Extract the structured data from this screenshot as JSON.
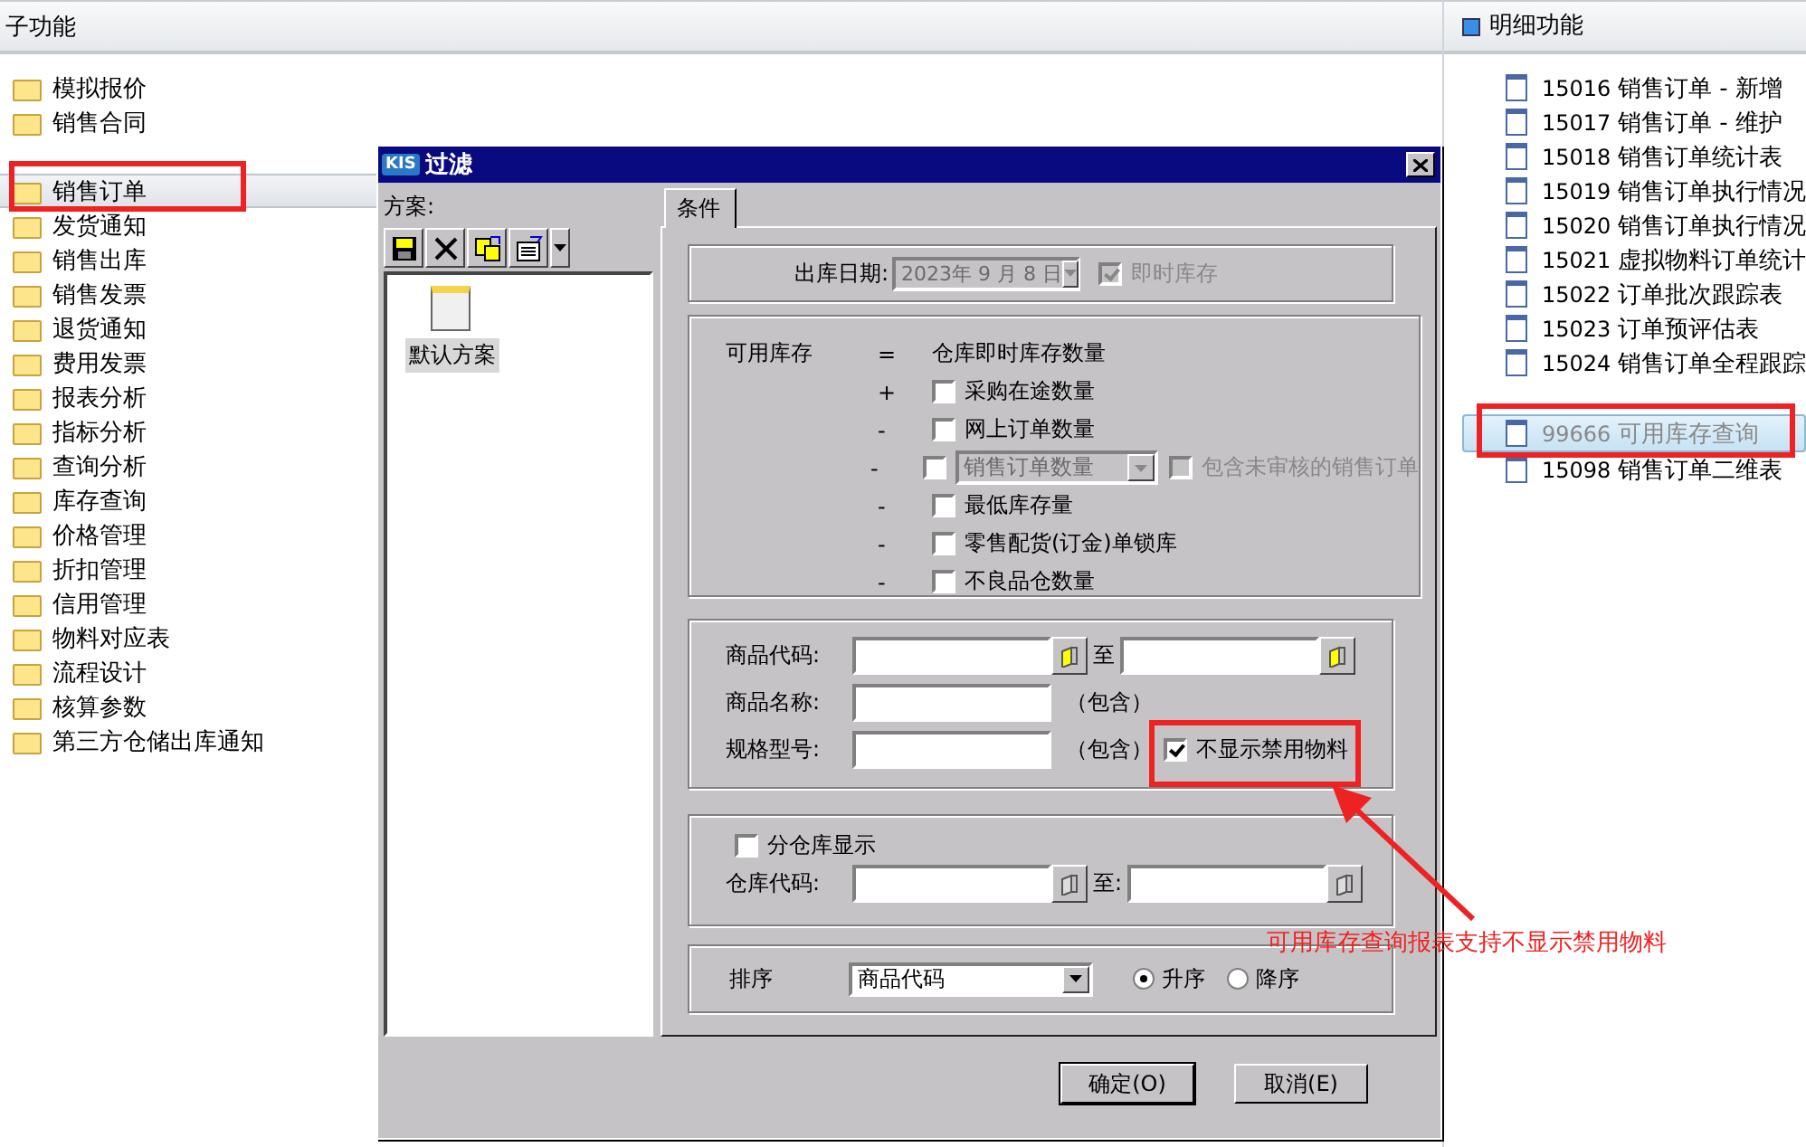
{
  "left_panel": {
    "header": "子功能",
    "items": [
      {
        "label": "模拟报价",
        "selected": false
      },
      {
        "label": "销售合同",
        "selected": false
      },
      {
        "label": "销售订单",
        "selected": true
      },
      {
        "label": "发货通知",
        "selected": false
      },
      {
        "label": "销售出库",
        "selected": false
      },
      {
        "label": "销售发票",
        "selected": false
      },
      {
        "label": "退货通知",
        "selected": false
      },
      {
        "label": "费用发票",
        "selected": false
      },
      {
        "label": "报表分析",
        "selected": false
      },
      {
        "label": "指标分析",
        "selected": false
      },
      {
        "label": "查询分析",
        "selected": false
      },
      {
        "label": "库存查询",
        "selected": false
      },
      {
        "label": "价格管理",
        "selected": false
      },
      {
        "label": "折扣管理",
        "selected": false
      },
      {
        "label": "信用管理",
        "selected": false
      },
      {
        "label": "物料对应表",
        "selected": false
      },
      {
        "label": "流程设计",
        "selected": false
      },
      {
        "label": "核算参数",
        "selected": false
      },
      {
        "label": "第三方仓储出库通知",
        "selected": false
      }
    ]
  },
  "right_panel": {
    "header": "明细功能",
    "items": [
      {
        "code": "15016",
        "label": "销售订单 - 新增",
        "selected": false
      },
      {
        "code": "15017",
        "label": "销售订单 - 维护",
        "selected": false
      },
      {
        "code": "15018",
        "label": "销售订单统计表",
        "selected": false
      },
      {
        "code": "15019",
        "label": "销售订单执行情况",
        "selected": false
      },
      {
        "code": "15020",
        "label": "销售订单执行情况",
        "selected": false
      },
      {
        "code": "15021",
        "label": "虚拟物料订单统计",
        "selected": false
      },
      {
        "code": "15022",
        "label": "订单批次跟踪表",
        "selected": false
      },
      {
        "code": "15023",
        "label": "订单预评估表",
        "selected": false
      },
      {
        "code": "15024",
        "label": "销售订单全程跟踪",
        "selected": false
      },
      {
        "code": "99666",
        "label": "可用库存查询",
        "selected": true
      },
      {
        "code": "15098",
        "label": "销售订单二维表",
        "selected": false
      }
    ]
  },
  "dialog": {
    "logo": "KIS",
    "title": "过滤",
    "scheme_label": "方案:",
    "schemes": [
      {
        "label": "默认方案",
        "selected": true
      }
    ],
    "tabs": [
      {
        "label": "条件",
        "selected": true
      }
    ],
    "date": {
      "label": "出库日期:",
      "value": "2023年 9 月 8 日",
      "disabled": true
    },
    "instant_stock": {
      "label": "即时库存",
      "checked": true,
      "disabled": true
    },
    "formula": {
      "label": "可用库存",
      "equals": "=",
      "base": "仓库即时库存数量",
      "terms": [
        {
          "kind": "check",
          "sign": "+",
          "label": "采购在途数量",
          "checked": false
        },
        {
          "kind": "check",
          "sign": "-",
          "label": "网上订单数量",
          "checked": false
        },
        {
          "kind": "select",
          "sign": "-",
          "value": "销售订单数量",
          "checked": false,
          "option": {
            "label": "包含未审核的销售订单",
            "checked": false
          }
        },
        {
          "kind": "check",
          "sign": "-",
          "label": "最低库存量",
          "checked": false
        },
        {
          "kind": "check",
          "sign": "-",
          "label": "零售配货(订金)单锁库",
          "checked": false
        },
        {
          "kind": "check",
          "sign": "-",
          "label": "不良品仓数量",
          "checked": false
        }
      ]
    },
    "product": {
      "code_label": "商品代码:",
      "to": "至",
      "name_label": "商品名称:",
      "name_hint": "（包含）",
      "spec_label": "规格型号:",
      "spec_hint": "（包含）",
      "hide_disabled": {
        "label": "不显示禁用物料",
        "checked": true
      }
    },
    "warehouse": {
      "split": {
        "label": "分仓库显示",
        "checked": false
      },
      "code_label": "仓库代码:",
      "to": "至:"
    },
    "sort": {
      "label": "排序",
      "value": "商品代码",
      "orders": [
        {
          "label": "升序",
          "selected": true
        },
        {
          "label": "降序",
          "selected": false
        }
      ]
    },
    "buttons": [
      {
        "label": "确定(O)",
        "default": true
      },
      {
        "label": "取消(E)",
        "default": false
      }
    ]
  },
  "annotation": {
    "text": "可用库存查询报表支持不显示禁用物料"
  }
}
